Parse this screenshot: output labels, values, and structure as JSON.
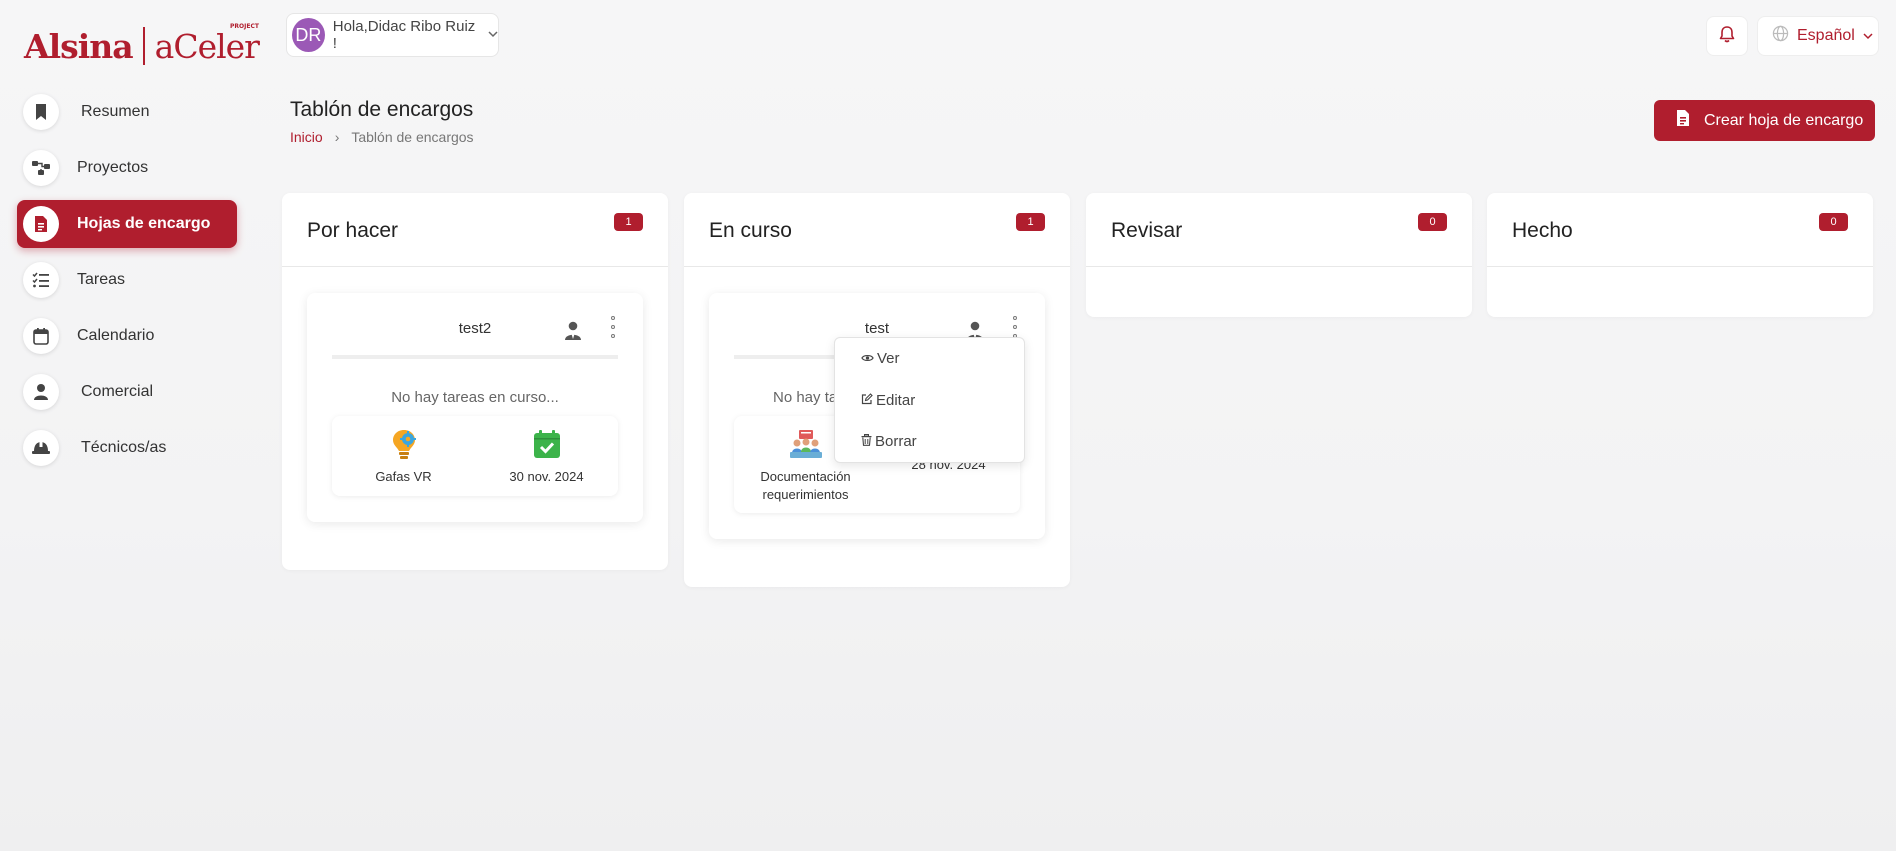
{
  "brand": {
    "name_left": "Alsina",
    "name_right": "aCeler",
    "name_right_sup": "PROJECT"
  },
  "header": {
    "user_initials": "DR",
    "greeting": "Hola,Didac Ribo Ruiz !",
    "language": "Español"
  },
  "sidebar": {
    "items": [
      {
        "label": "Resumen",
        "icon": "bookmark-icon"
      },
      {
        "label": "Proyectos",
        "icon": "project-tree-icon"
      },
      {
        "label": "Hojas de encargo",
        "icon": "document-icon",
        "active": true
      },
      {
        "label": "Tareas",
        "icon": "checklist-icon"
      },
      {
        "label": "Calendario",
        "icon": "calendar-icon"
      },
      {
        "label": "Comercial",
        "icon": "person-icon"
      },
      {
        "label": "Técnicos/as",
        "icon": "hard-hat-icon"
      }
    ]
  },
  "page": {
    "title": "Tablón de encargos",
    "breadcrumb": {
      "home": "Inicio",
      "separator": "›",
      "current": "Tablón de encargos"
    },
    "create_button": "Crear hoja de encargo"
  },
  "board": {
    "columns": [
      {
        "title": "Por hacer",
        "count": "1",
        "cards": [
          {
            "title": "test2",
            "status_text": "No hay tareas en curso...",
            "project": "Gafas VR",
            "date": "30 nov. 2024"
          }
        ]
      },
      {
        "title": "En curso",
        "count": "1",
        "cards": [
          {
            "title": "test",
            "status_text": "No hay ta",
            "project": "Documentación requerimientos",
            "date": "28 nov. 2024"
          }
        ]
      },
      {
        "title": "Revisar",
        "count": "0",
        "cards": []
      },
      {
        "title": "Hecho",
        "count": "0",
        "cards": []
      }
    ]
  },
  "card_menu": {
    "view": "Ver",
    "edit": "Editar",
    "delete": "Borrar"
  },
  "colors": {
    "brand": "#b01e2e",
    "avatar": "#9b59b6",
    "calendar_green": "#3cb34a"
  }
}
